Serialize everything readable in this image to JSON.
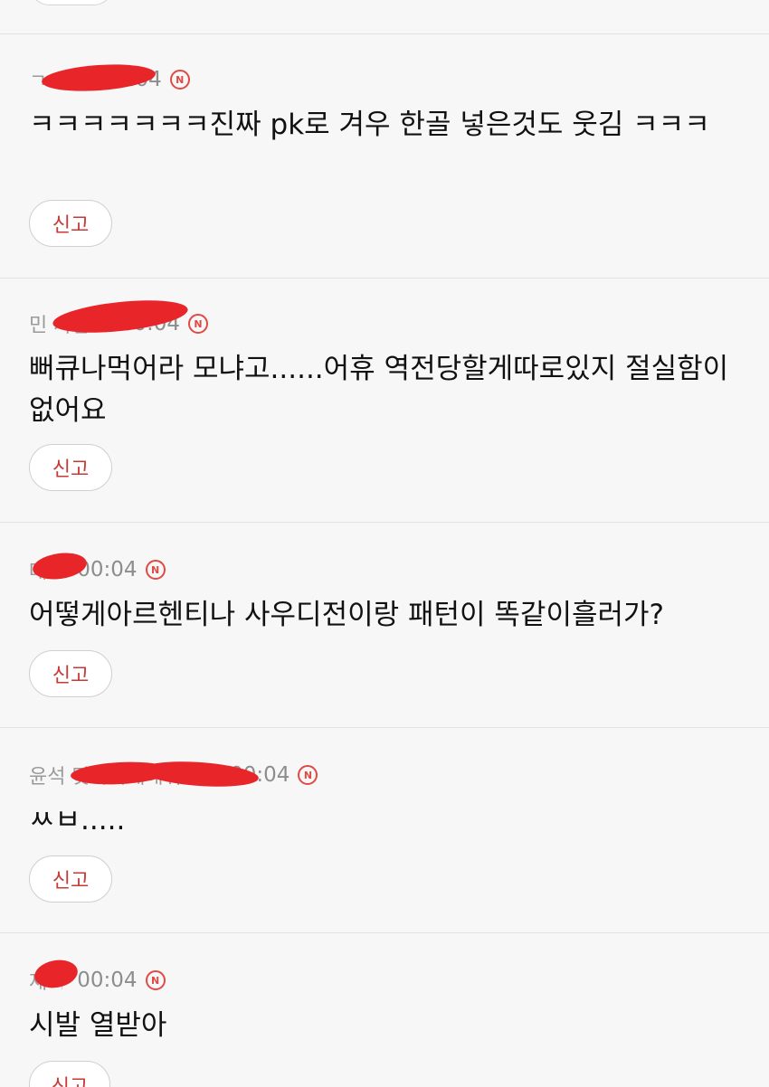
{
  "report_label": "신고",
  "badge_letter": "N",
  "comments": [
    {
      "nickname": "ㄱ               피",
      "time": "00:04",
      "text": "ㅋㅋㅋㅋㅋㅋㅋ진짜 pk로 겨우 한골 넣은것도 웃김 ㅋㅋㅋ"
    },
    {
      "nickname": "민              사람",
      "time": "00:04",
      "text": "뻐큐나먹어라 모냐고......어휴 역전당할게따로있지 절실함이없어요"
    },
    {
      "nickname": "대  ",
      "time": "00:04",
      "text": "어떻게아르헨티나 사우디전이랑 패턴이 똑같이흘러가?"
    },
    {
      "nickname": "윤석                    맞아죽게해줘라",
      "time": "00:04",
      "text": "ㅆㅂ....."
    },
    {
      "nickname": "재  ",
      "time": "00:04",
      "text": "시발 열받아"
    }
  ]
}
